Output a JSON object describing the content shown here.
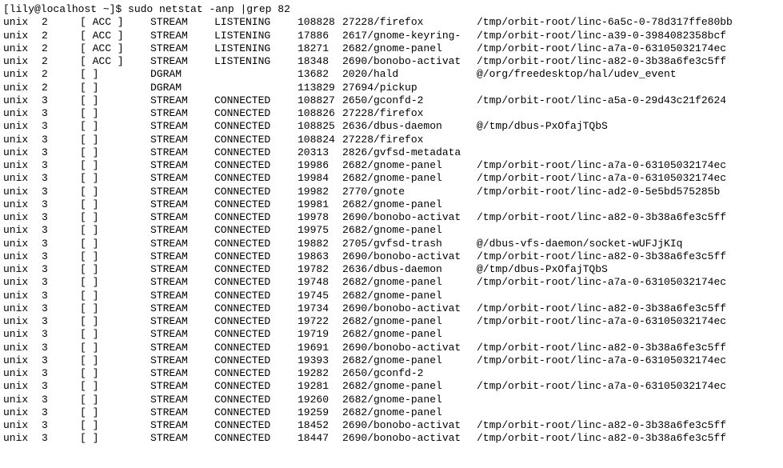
{
  "prompt": "[lily@localhost ~]$ ",
  "command": "sudo netstat -anp |grep 82",
  "rows": [
    {
      "proto": "unix",
      "refcnt": "2",
      "flags": "[ ACC ]",
      "type": "STREAM",
      "state": "LISTENING",
      "inode": "108828",
      "pidprog": "27228/firefox",
      "path": "/tmp/orbit-root/linc-6a5c-0-78d317ffe80bb"
    },
    {
      "proto": "unix",
      "refcnt": "2",
      "flags": "[ ACC ]",
      "type": "STREAM",
      "state": "LISTENING",
      "inode": "17886",
      "pidprog": "2617/gnome-keyring-",
      "path": "/tmp/orbit-root/linc-a39-0-3984082358bcf"
    },
    {
      "proto": "unix",
      "refcnt": "2",
      "flags": "[ ACC ]",
      "type": "STREAM",
      "state": "LISTENING",
      "inode": "18271",
      "pidprog": "2682/gnome-panel",
      "path": "/tmp/orbit-root/linc-a7a-0-63105032174ec"
    },
    {
      "proto": "unix",
      "refcnt": "2",
      "flags": "[ ACC ]",
      "type": "STREAM",
      "state": "LISTENING",
      "inode": "18348",
      "pidprog": "2690/bonobo-activat",
      "path": "/tmp/orbit-root/linc-a82-0-3b38a6fe3c5ff"
    },
    {
      "proto": "unix",
      "refcnt": "2",
      "flags": "[ ]",
      "type": "DGRAM",
      "state": "",
      "inode": "13682",
      "pidprog": "2020/hald",
      "path": "@/org/freedesktop/hal/udev_event"
    },
    {
      "proto": "unix",
      "refcnt": "2",
      "flags": "[ ]",
      "type": "DGRAM",
      "state": "",
      "inode": "113829",
      "pidprog": "27694/pickup",
      "path": ""
    },
    {
      "proto": "unix",
      "refcnt": "3",
      "flags": "[ ]",
      "type": "STREAM",
      "state": "CONNECTED",
      "inode": "108827",
      "pidprog": "2650/gconfd-2",
      "path": "/tmp/orbit-root/linc-a5a-0-29d43c21f2624"
    },
    {
      "proto": "unix",
      "refcnt": "3",
      "flags": "[ ]",
      "type": "STREAM",
      "state": "CONNECTED",
      "inode": "108826",
      "pidprog": "27228/firefox",
      "path": ""
    },
    {
      "proto": "unix",
      "refcnt": "3",
      "flags": "[ ]",
      "type": "STREAM",
      "state": "CONNECTED",
      "inode": "108825",
      "pidprog": "2636/dbus-daemon",
      "path": "@/tmp/dbus-PxOfajTQbS"
    },
    {
      "proto": "unix",
      "refcnt": "3",
      "flags": "[ ]",
      "type": "STREAM",
      "state": "CONNECTED",
      "inode": "108824",
      "pidprog": "27228/firefox",
      "path": ""
    },
    {
      "proto": "unix",
      "refcnt": "3",
      "flags": "[ ]",
      "type": "STREAM",
      "state": "CONNECTED",
      "inode": "20313",
      "pidprog": "2826/gvfsd-metadata",
      "path": ""
    },
    {
      "proto": "unix",
      "refcnt": "3",
      "flags": "[ ]",
      "type": "STREAM",
      "state": "CONNECTED",
      "inode": "19986",
      "pidprog": "2682/gnome-panel",
      "path": "/tmp/orbit-root/linc-a7a-0-63105032174ec"
    },
    {
      "proto": "unix",
      "refcnt": "3",
      "flags": "[ ]",
      "type": "STREAM",
      "state": "CONNECTED",
      "inode": "19984",
      "pidprog": "2682/gnome-panel",
      "path": "/tmp/orbit-root/linc-a7a-0-63105032174ec"
    },
    {
      "proto": "unix",
      "refcnt": "3",
      "flags": "[ ]",
      "type": "STREAM",
      "state": "CONNECTED",
      "inode": "19982",
      "pidprog": "2770/gnote",
      "path": "/tmp/orbit-root/linc-ad2-0-5e5bd575285b"
    },
    {
      "proto": "unix",
      "refcnt": "3",
      "flags": "[ ]",
      "type": "STREAM",
      "state": "CONNECTED",
      "inode": "19981",
      "pidprog": "2682/gnome-panel",
      "path": ""
    },
    {
      "proto": "unix",
      "refcnt": "3",
      "flags": "[ ]",
      "type": "STREAM",
      "state": "CONNECTED",
      "inode": "19978",
      "pidprog": "2690/bonobo-activat",
      "path": "/tmp/orbit-root/linc-a82-0-3b38a6fe3c5ff"
    },
    {
      "proto": "unix",
      "refcnt": "3",
      "flags": "[ ]",
      "type": "STREAM",
      "state": "CONNECTED",
      "inode": "19975",
      "pidprog": "2682/gnome-panel",
      "path": ""
    },
    {
      "proto": "unix",
      "refcnt": "3",
      "flags": "[ ]",
      "type": "STREAM",
      "state": "CONNECTED",
      "inode": "19882",
      "pidprog": "2705/gvfsd-trash",
      "path": "@/dbus-vfs-daemon/socket-wUFJjKIq"
    },
    {
      "proto": "unix",
      "refcnt": "3",
      "flags": "[ ]",
      "type": "STREAM",
      "state": "CONNECTED",
      "inode": "19863",
      "pidprog": "2690/bonobo-activat",
      "path": "/tmp/orbit-root/linc-a82-0-3b38a6fe3c5ff"
    },
    {
      "proto": "unix",
      "refcnt": "3",
      "flags": "[ ]",
      "type": "STREAM",
      "state": "CONNECTED",
      "inode": "19782",
      "pidprog": "2636/dbus-daemon",
      "path": "@/tmp/dbus-PxOfajTQbS"
    },
    {
      "proto": "unix",
      "refcnt": "3",
      "flags": "[ ]",
      "type": "STREAM",
      "state": "CONNECTED",
      "inode": "19748",
      "pidprog": "2682/gnome-panel",
      "path": "/tmp/orbit-root/linc-a7a-0-63105032174ec"
    },
    {
      "proto": "unix",
      "refcnt": "3",
      "flags": "[ ]",
      "type": "STREAM",
      "state": "CONNECTED",
      "inode": "19745",
      "pidprog": "2682/gnome-panel",
      "path": ""
    },
    {
      "proto": "unix",
      "refcnt": "3",
      "flags": "[ ]",
      "type": "STREAM",
      "state": "CONNECTED",
      "inode": "19734",
      "pidprog": "2690/bonobo-activat",
      "path": "/tmp/orbit-root/linc-a82-0-3b38a6fe3c5ff"
    },
    {
      "proto": "unix",
      "refcnt": "3",
      "flags": "[ ]",
      "type": "STREAM",
      "state": "CONNECTED",
      "inode": "19722",
      "pidprog": "2682/gnome-panel",
      "path": "/tmp/orbit-root/linc-a7a-0-63105032174ec"
    },
    {
      "proto": "unix",
      "refcnt": "3",
      "flags": "[ ]",
      "type": "STREAM",
      "state": "CONNECTED",
      "inode": "19719",
      "pidprog": "2682/gnome-panel",
      "path": ""
    },
    {
      "proto": "unix",
      "refcnt": "3",
      "flags": "[ ]",
      "type": "STREAM",
      "state": "CONNECTED",
      "inode": "19691",
      "pidprog": "2690/bonobo-activat",
      "path": "/tmp/orbit-root/linc-a82-0-3b38a6fe3c5ff"
    },
    {
      "proto": "unix",
      "refcnt": "3",
      "flags": "[ ]",
      "type": "STREAM",
      "state": "CONNECTED",
      "inode": "19393",
      "pidprog": "2682/gnome-panel",
      "path": "/tmp/orbit-root/linc-a7a-0-63105032174ec"
    },
    {
      "proto": "unix",
      "refcnt": "3",
      "flags": "[ ]",
      "type": "STREAM",
      "state": "CONNECTED",
      "inode": "19282",
      "pidprog": "2650/gconfd-2",
      "path": ""
    },
    {
      "proto": "unix",
      "refcnt": "3",
      "flags": "[ ]",
      "type": "STREAM",
      "state": "CONNECTED",
      "inode": "19281",
      "pidprog": "2682/gnome-panel",
      "path": "/tmp/orbit-root/linc-a7a-0-63105032174ec"
    },
    {
      "proto": "unix",
      "refcnt": "3",
      "flags": "[ ]",
      "type": "STREAM",
      "state": "CONNECTED",
      "inode": "19260",
      "pidprog": "2682/gnome-panel",
      "path": ""
    },
    {
      "proto": "unix",
      "refcnt": "3",
      "flags": "[ ]",
      "type": "STREAM",
      "state": "CONNECTED",
      "inode": "19259",
      "pidprog": "2682/gnome-panel",
      "path": ""
    },
    {
      "proto": "unix",
      "refcnt": "3",
      "flags": "[ ]",
      "type": "STREAM",
      "state": "CONNECTED",
      "inode": "18452",
      "pidprog": "2690/bonobo-activat",
      "path": "/tmp/orbit-root/linc-a82-0-3b38a6fe3c5ff"
    },
    {
      "proto": "unix",
      "refcnt": "3",
      "flags": "[ ]",
      "type": "STREAM",
      "state": "CONNECTED",
      "inode": "18447",
      "pidprog": "2690/bonobo-activat",
      "path": "/tmp/orbit-root/linc-a82-0-3b38a6fe3c5ff"
    }
  ]
}
